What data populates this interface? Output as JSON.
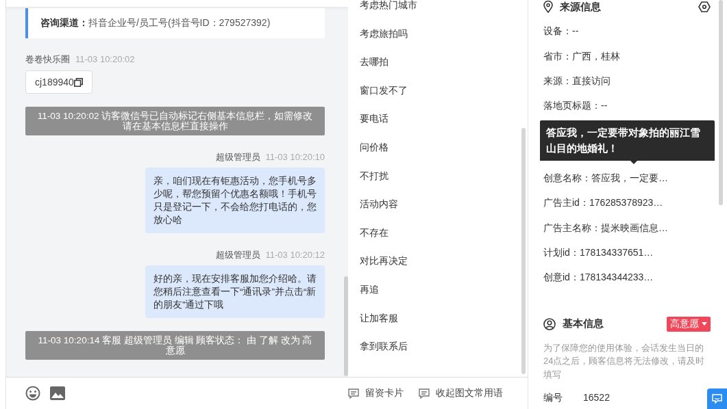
{
  "chat": {
    "channel": {
      "label": "咨询渠道：",
      "value": "抖音企业号/员工号(抖音号ID：279527392)"
    },
    "messages": [
      {
        "kind": "visitor",
        "sender": "卷卷快乐圈",
        "time": "11-03 10:20:02",
        "text": "cj189940"
      },
      {
        "kind": "system",
        "text": "11-03 10:20:02 访客微信号已自动标记右侧基本信息栏，如需修改请在基本信息栏直接操作"
      },
      {
        "kind": "agent",
        "sender": "超级管理员",
        "time": "11-03 10:20:10",
        "text": "亲，咱们现在有钜惠活动，您手机号多少呢，帮您预留个优惠名额哦！手机号只是登记一下，不会给您打电话的，您放心哈"
      },
      {
        "kind": "agent",
        "sender": "超级管理员",
        "time": "11-03 10:20:12",
        "text": "好的亲，现在安排客服加您介绍哈。请您稍后注意查看一下“通讯录”并点击“新的朋友”通过下哦"
      },
      {
        "kind": "system",
        "text": "11-03 10:20:14 客服 超级管理员 编辑 顾客状态： 由 了解 改为 高意愿"
      }
    ]
  },
  "phrases": {
    "items": [
      "考虑热门城市",
      "考虑旅拍吗",
      "去哪拍",
      "窗口发不了",
      "要电话",
      "问价格",
      "不打扰",
      "活动内容",
      "不存在",
      "对比再决定",
      "再追",
      "让加客服",
      "拿到联系后"
    ],
    "actions": [
      "留资卡片",
      "收起图文常用语"
    ]
  },
  "source_info": {
    "title": "来源信息",
    "fields": [
      {
        "kind": "field",
        "text": "设备：--"
      },
      {
        "kind": "field",
        "text": "省市：广西，桂林"
      },
      {
        "kind": "field",
        "text": "来源：直接访问"
      },
      {
        "kind": "field",
        "text": "落地页标题：--"
      },
      {
        "kind": "tooltip",
        "text": "答应我，一定要带对象拍的丽江雪山目的地婚礼！"
      },
      {
        "kind": "field",
        "text": "创意名称：答应我，一定要…"
      },
      {
        "kind": "field",
        "text": "广告主id：176285378923…"
      },
      {
        "kind": "field",
        "text": "广告主名称：提米映画信息…"
      },
      {
        "kind": "field",
        "text": "计划id：178134337651…"
      },
      {
        "kind": "field",
        "text": "创意id：178134344233…"
      }
    ]
  },
  "basic_info": {
    "title": "基本信息",
    "intent_tag": "高意愿",
    "notice": "为了保障您的使用体验，会话发生当日的24点之后，顾客信息将无法修改，请及时填写",
    "fields": [
      {
        "label": "编号",
        "value": "16522"
      }
    ]
  }
}
